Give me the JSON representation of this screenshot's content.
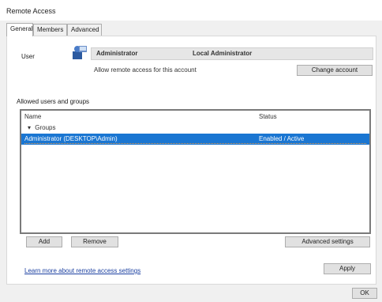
{
  "window": {
    "title": "Remote Access"
  },
  "tabs": [
    {
      "label": "General"
    },
    {
      "label": "Members"
    },
    {
      "label": "Advanced"
    }
  ],
  "user_section": {
    "label": "User",
    "account_name": "Administrator",
    "account_role": "Local Administrator",
    "account_detail": "Allow remote access for this account",
    "change_button": "Change account"
  },
  "list": {
    "title": "Allowed users and groups",
    "columns": [
      "Name",
      "Status"
    ],
    "group_label": "Groups",
    "rows": [
      {
        "name": "Administrator (DESKTOP\\Admin)",
        "status": "Enabled / Active"
      }
    ]
  },
  "buttons": {
    "add": "Add",
    "remove": "Remove",
    "advanced": "Advanced settings",
    "ok": "Apply"
  },
  "link": {
    "text": "Learn more about remote access settings"
  },
  "footer": {
    "corner_label": "OK"
  },
  "colors": {
    "selection": "#1a76d2",
    "dotted_line": "#f2a24a",
    "window_bg": "#f0f0f0"
  },
  "icons": {
    "user": "user-icon",
    "group_chevron": "chevron-down-icon"
  }
}
